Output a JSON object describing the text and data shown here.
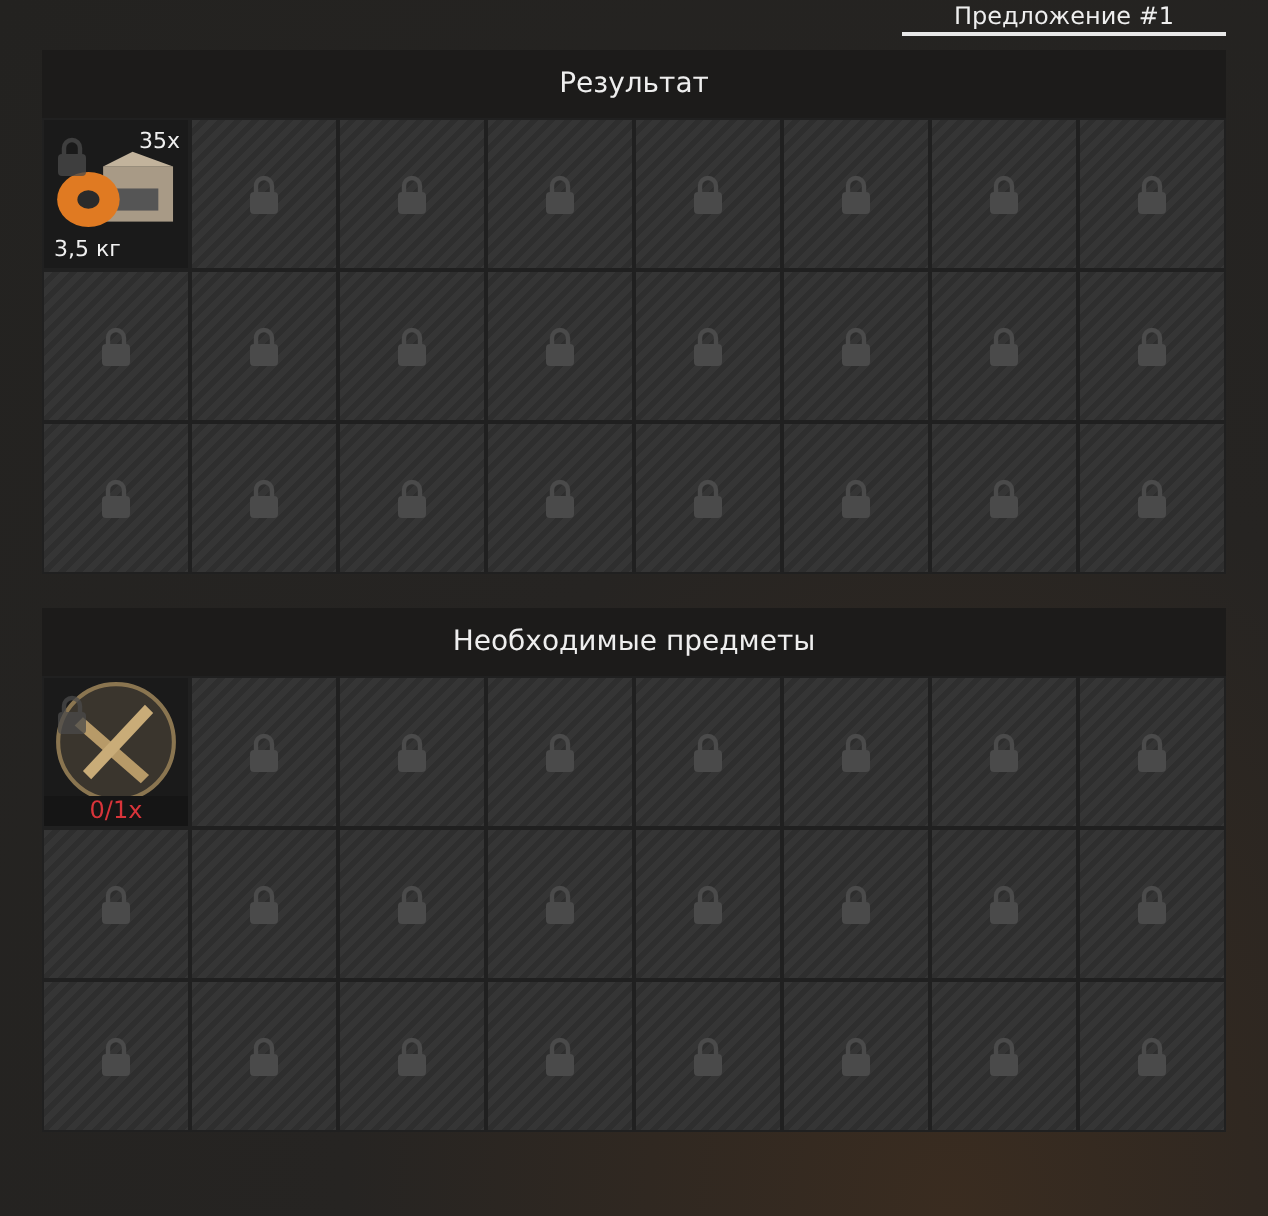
{
  "tab": {
    "label": "Предложение #1",
    "selected": true
  },
  "sections": [
    {
      "title": "Результат",
      "slots": [
        {
          "kind": "item",
          "locked": true,
          "count": "35x",
          "weight": "3,5 кг"
        },
        {
          "kind": "empty",
          "locked": true
        },
        {
          "kind": "empty",
          "locked": true
        },
        {
          "kind": "empty",
          "locked": true
        },
        {
          "kind": "empty",
          "locked": true
        },
        {
          "kind": "empty",
          "locked": true
        },
        {
          "kind": "empty",
          "locked": true
        },
        {
          "kind": "empty",
          "locked": true
        },
        {
          "kind": "empty",
          "locked": true
        },
        {
          "kind": "empty",
          "locked": true
        },
        {
          "kind": "empty",
          "locked": true
        },
        {
          "kind": "empty",
          "locked": true
        },
        {
          "kind": "empty",
          "locked": true
        },
        {
          "kind": "empty",
          "locked": true
        },
        {
          "kind": "empty",
          "locked": true
        },
        {
          "kind": "empty",
          "locked": true
        },
        {
          "kind": "empty",
          "locked": true
        },
        {
          "kind": "empty",
          "locked": true
        },
        {
          "kind": "empty",
          "locked": true
        },
        {
          "kind": "empty",
          "locked": true
        },
        {
          "kind": "empty",
          "locked": true
        },
        {
          "kind": "empty",
          "locked": true
        },
        {
          "kind": "empty",
          "locked": true
        },
        {
          "kind": "empty",
          "locked": true
        }
      ]
    },
    {
      "title": "Необходимые предметы",
      "slots": [
        {
          "kind": "required",
          "locked": true,
          "count": "0/1x",
          "sufficient": false
        },
        {
          "kind": "empty",
          "locked": true
        },
        {
          "kind": "empty",
          "locked": true
        },
        {
          "kind": "empty",
          "locked": true
        },
        {
          "kind": "empty",
          "locked": true
        },
        {
          "kind": "empty",
          "locked": true
        },
        {
          "kind": "empty",
          "locked": true
        },
        {
          "kind": "empty",
          "locked": true
        },
        {
          "kind": "empty",
          "locked": true
        },
        {
          "kind": "empty",
          "locked": true
        },
        {
          "kind": "empty",
          "locked": true
        },
        {
          "kind": "empty",
          "locked": true
        },
        {
          "kind": "empty",
          "locked": true
        },
        {
          "kind": "empty",
          "locked": true
        },
        {
          "kind": "empty",
          "locked": true
        },
        {
          "kind": "empty",
          "locked": true
        },
        {
          "kind": "empty",
          "locked": true
        },
        {
          "kind": "empty",
          "locked": true
        },
        {
          "kind": "empty",
          "locked": true
        },
        {
          "kind": "empty",
          "locked": true
        },
        {
          "kind": "empty",
          "locked": true
        },
        {
          "kind": "empty",
          "locked": true
        },
        {
          "kind": "empty",
          "locked": true
        },
        {
          "kind": "empty",
          "locked": true
        }
      ]
    }
  ]
}
